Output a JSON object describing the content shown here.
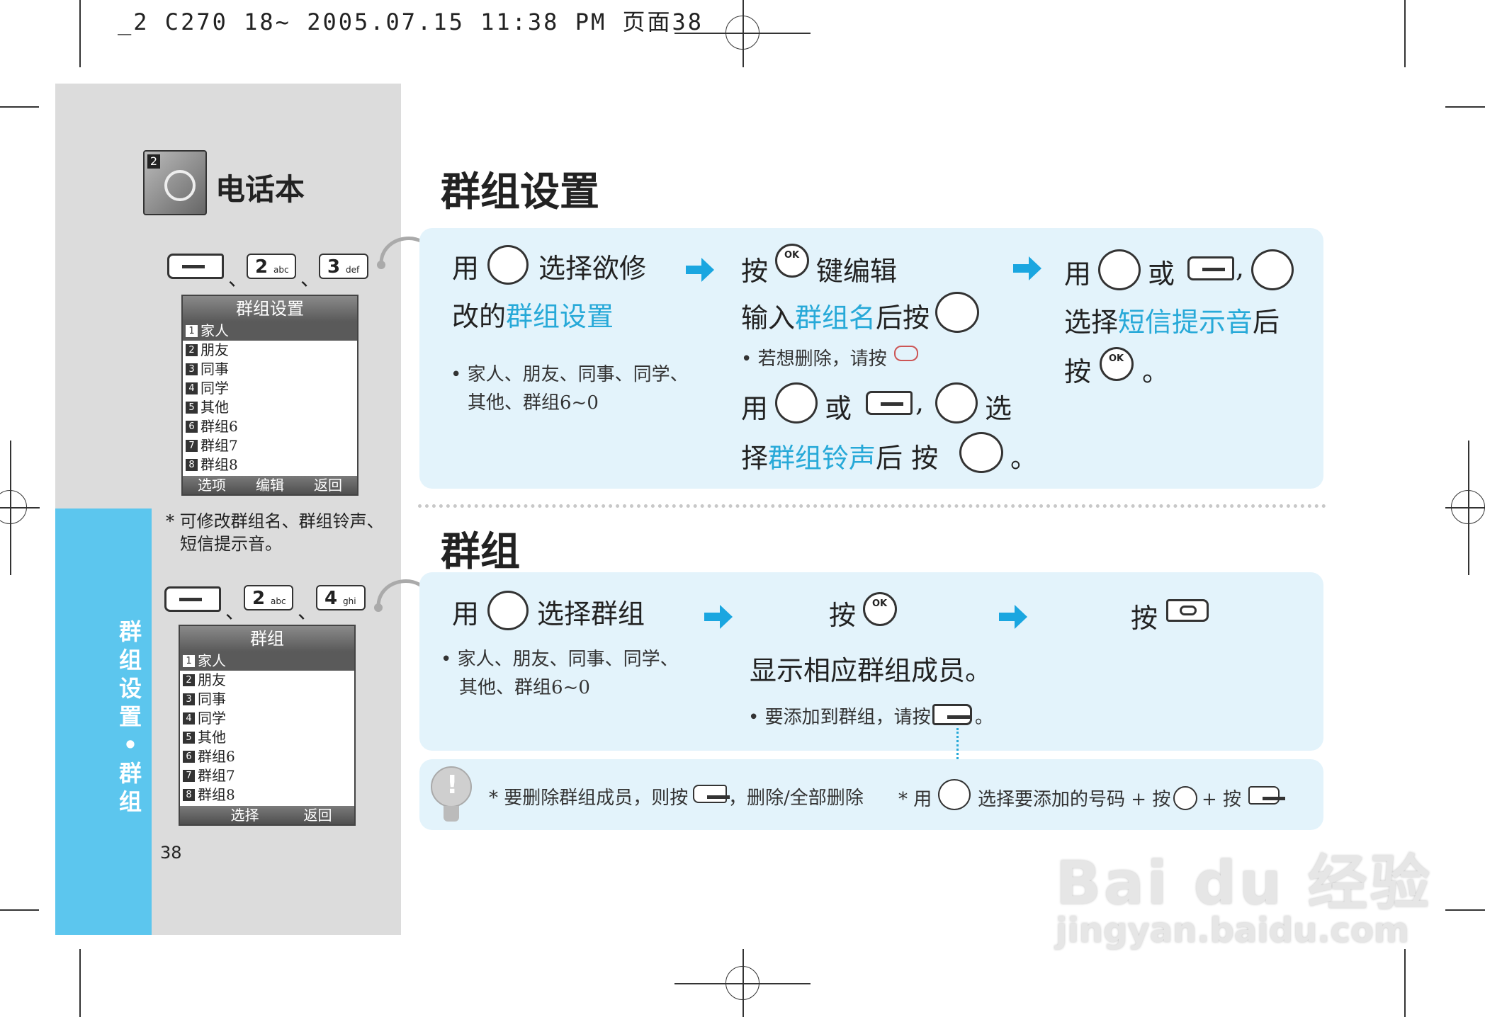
{
  "header_line": "_2 C270 18~ 2005.07.15 11:38 PM 页面38",
  "chapter": {
    "title": "电话本"
  },
  "sidebar": {
    "vertical_label": "群组设置•群组",
    "page_number": "38",
    "note": "* 可修改群组名、群组铃声、",
    "note2": "短信提示音。",
    "sep": "、",
    "screen1": {
      "title": "群组设置",
      "items": [
        "家人",
        "朋友",
        "同事",
        "同学",
        "其他",
        "群组6",
        "群组7",
        "群组8"
      ],
      "softkeys": [
        "选项",
        "编辑",
        "返回"
      ]
    },
    "screen2": {
      "title": "群组",
      "items": [
        "家人",
        "朋友",
        "同事",
        "同学",
        "其他",
        "群组6",
        "群组7",
        "群组8"
      ],
      "softkeys": [
        "选择",
        "返回"
      ]
    },
    "keys1": [
      "2",
      "3"
    ],
    "keys2": [
      "2",
      "4"
    ]
  },
  "section1": {
    "title": "群组设置",
    "step1": {
      "a": "用",
      "b": "选择欲修",
      "c": "改的",
      "d": "群组设置",
      "note1": "• 家人、朋友、同事、同学、",
      "note2": "其他、群组6~0"
    },
    "step2": {
      "a": "按",
      "b": "键编辑",
      "c": "输入",
      "d": "群组名",
      "e": "后按",
      "note": "• 若想删除，请按",
      "f": "用",
      "g": "或",
      "h": ",",
      "i": "选",
      "j": "择",
      "k": "群组铃声",
      "l": "后  按",
      "m": "。"
    },
    "step3": {
      "a": "用",
      "b": "或",
      "c": ",",
      "d": "选择",
      "e": "短信提示音",
      "f": "后",
      "g": "按",
      "h": "。"
    }
  },
  "section2": {
    "title": "群组",
    "step1": {
      "a": "用",
      "b": "选择群组",
      "note1": "• 家人、朋友、同事、同学、",
      "note2": "其他、群组6~0"
    },
    "step2": {
      "a": "按",
      "b": "显示相应群组成员。",
      "note": "• 要添加到群组，请按",
      "dot": "。"
    },
    "step3": {
      "a": "按"
    }
  },
  "tip": {
    "left": "* 要删除群组成员，则按",
    "left2": "，删除/全部删除",
    "right_a": "* 用",
    "right_b": "选择要添加的号码 + 按",
    "right_c": "+ 按"
  },
  "watermark": {
    "brand": "Bai du 经验",
    "url": "jingyan.baidu.com"
  },
  "colors": {
    "accent": "#27a9d8",
    "panel": "#e3f3fb",
    "sidebar": "#dcdcdc",
    "tab": "#5cc6ee",
    "arrow": "#1aa6e0"
  }
}
